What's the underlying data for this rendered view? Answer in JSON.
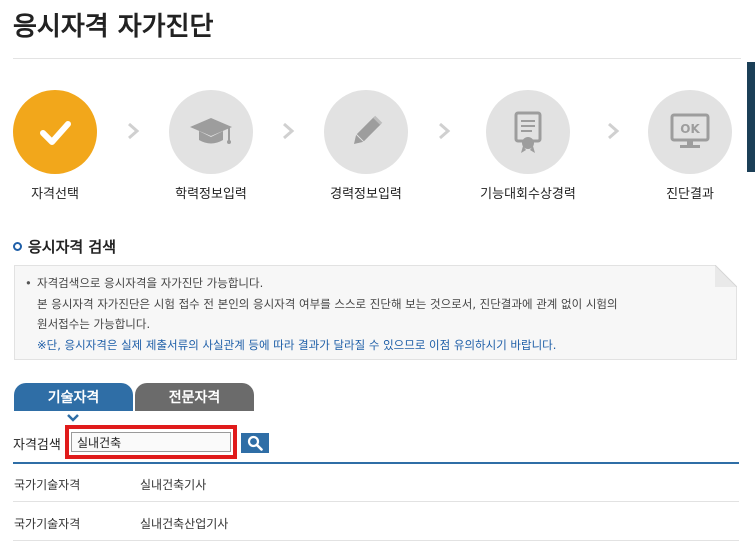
{
  "header": {
    "title": "응시자격 자가진단"
  },
  "steps": [
    {
      "label": "자격선택",
      "icon": "check-icon",
      "active": true
    },
    {
      "label": "학력정보입력",
      "icon": "graduation-cap-icon",
      "active": false
    },
    {
      "label": "경력정보입력",
      "icon": "pencil-icon",
      "active": false
    },
    {
      "label": "기능대회수상경력",
      "icon": "certificate-icon",
      "active": false
    },
    {
      "label": "진단결과",
      "icon": "ok-monitor-icon",
      "active": false
    }
  ],
  "section": {
    "title": "응시자격 검색"
  },
  "notice": {
    "line1": "자격검색으로 응시자격을 자가진단 가능합니다.",
    "line2": "본 응시자격 자가진단은 시험 접수 전 본인의 응시자격 여부를 스스로 진단해 보는 것으로서, 진단결과에 관계 없이 시험의",
    "line3": "원서접수는 가능합니다.",
    "line4": "※단, 응시자격은 실제 제출서류의 사실관계 등에 따라 결과가 달라질 수 있으므로 이점 유의하시기 바랍니다."
  },
  "tabs": [
    {
      "label": "기술자격",
      "active": true
    },
    {
      "label": "전문자격",
      "active": false
    }
  ],
  "search": {
    "label": "자격검색",
    "value": "실내건축"
  },
  "results": [
    {
      "category": "국가기술자격",
      "name": "실내건축기사"
    },
    {
      "category": "국가기술자격",
      "name": "실내건축산업기사"
    }
  ],
  "colors": {
    "accent": "#2f6ea6",
    "active_step": "#f2a71b",
    "inactive_step": "#e2e2e2",
    "highlight": "#e01b1b"
  }
}
